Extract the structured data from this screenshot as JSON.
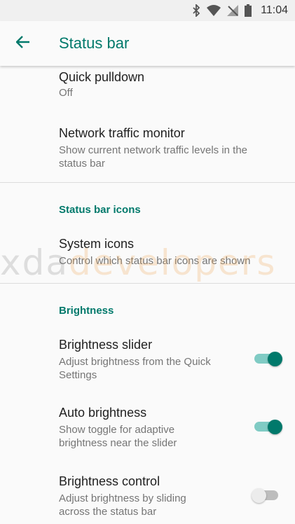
{
  "status_bar": {
    "time": "11:04",
    "icons": [
      "bluetooth-icon",
      "wifi-icon",
      "no-signal-icon",
      "battery-icon"
    ]
  },
  "header": {
    "title": "Status bar",
    "back_icon": "arrow-left-icon"
  },
  "colors": {
    "accent": "#00796b",
    "toggle_track_on": "#80cbc4"
  },
  "items": {
    "quick_pulldown": {
      "title": "Quick pulldown",
      "summary": "Off"
    },
    "network_traffic": {
      "title": "Network traffic monitor",
      "summary_l1": "Show current network traffic levels in the",
      "summary_l2": "status bar"
    }
  },
  "categories": {
    "icons": "Status bar icons",
    "brightness": "Brightness"
  },
  "system_icons": {
    "title": "System icons",
    "summary": "Control which status bar icons are shown"
  },
  "brightness": {
    "slider": {
      "title": "Brightness slider",
      "summary_l1": "Adjust brightness from the Quick",
      "summary_l2": "Settings",
      "enabled": true
    },
    "auto": {
      "title": "Auto brightness",
      "summary_l1": "Show toggle for adaptive",
      "summary_l2": "brightness near the slider",
      "enabled": true
    },
    "control": {
      "title": "Brightness control",
      "summary_l1": "Adjust brightness by sliding",
      "summary_l2": "across the status bar",
      "enabled": false
    }
  },
  "watermark": {
    "part1": "xda",
    "part2": "developers"
  }
}
